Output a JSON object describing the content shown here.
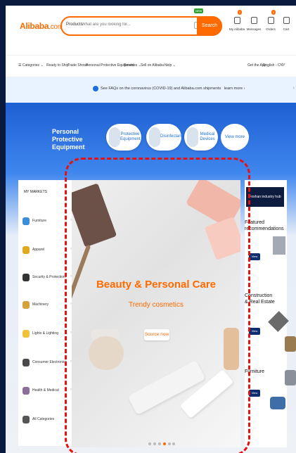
{
  "header": {
    "logo": "Alibaba",
    "logo_suffix": ".com",
    "search": {
      "category": "Products",
      "placeholder": "What are you looking for...",
      "button": "Search",
      "new_badge": "NEW"
    },
    "user_icons": [
      {
        "label": "My Alibaba",
        "count": "2"
      },
      {
        "label": "Messages",
        "count": ""
      },
      {
        "label": "Orders",
        "count": "0"
      },
      {
        "label": "Cart",
        "count": ""
      }
    ]
  },
  "nav": {
    "items": [
      "Categories",
      "Ready to Ship",
      "Trade Shows",
      "Personal Protective Equipment",
      "Services",
      "Sell on Alibaba",
      "Help"
    ],
    "right": [
      "Get the App",
      "English - CNY"
    ]
  },
  "notice": {
    "text": "See FAQs on the coronavirus (COVID-19) and Alibaba.com shipments",
    "link": "learn more"
  },
  "ppe": {
    "title": "Personal Protective Equipment",
    "pills": [
      "Protective Equipment",
      "Disinfectants",
      "Medical Devices"
    ],
    "view_more": "View more"
  },
  "markets": {
    "header": "MY MARKETS",
    "items": [
      {
        "label": "Furniture",
        "color": "#3c8dd8"
      },
      {
        "label": "Apparel",
        "color": "#e1a91f"
      },
      {
        "label": "Security & Protection",
        "color": "#333333"
      },
      {
        "label": "Machinery",
        "color": "#d5a13a"
      },
      {
        "label": "Lights & Lighting",
        "color": "#f0c23b"
      },
      {
        "label": "Consumer Electronics",
        "color": "#4a4a4a"
      },
      {
        "label": "Health & Medical",
        "color": "#8c6e9a"
      },
      {
        "label": "All Categories",
        "color": "#555555"
      }
    ]
  },
  "banner": {
    "title": "Beauty & Personal Care",
    "subtitle": "Trendy cosmetics",
    "button": "Source now",
    "dots": 6,
    "active_dot": 3
  },
  "side": {
    "header": "Foshan industry hub",
    "cards": [
      {
        "title": "Featured recommendations",
        "button": "View more"
      },
      {
        "title": "Construction & Real Estate",
        "button": "View more"
      },
      {
        "title": "Furniture",
        "button": "View more"
      }
    ]
  }
}
